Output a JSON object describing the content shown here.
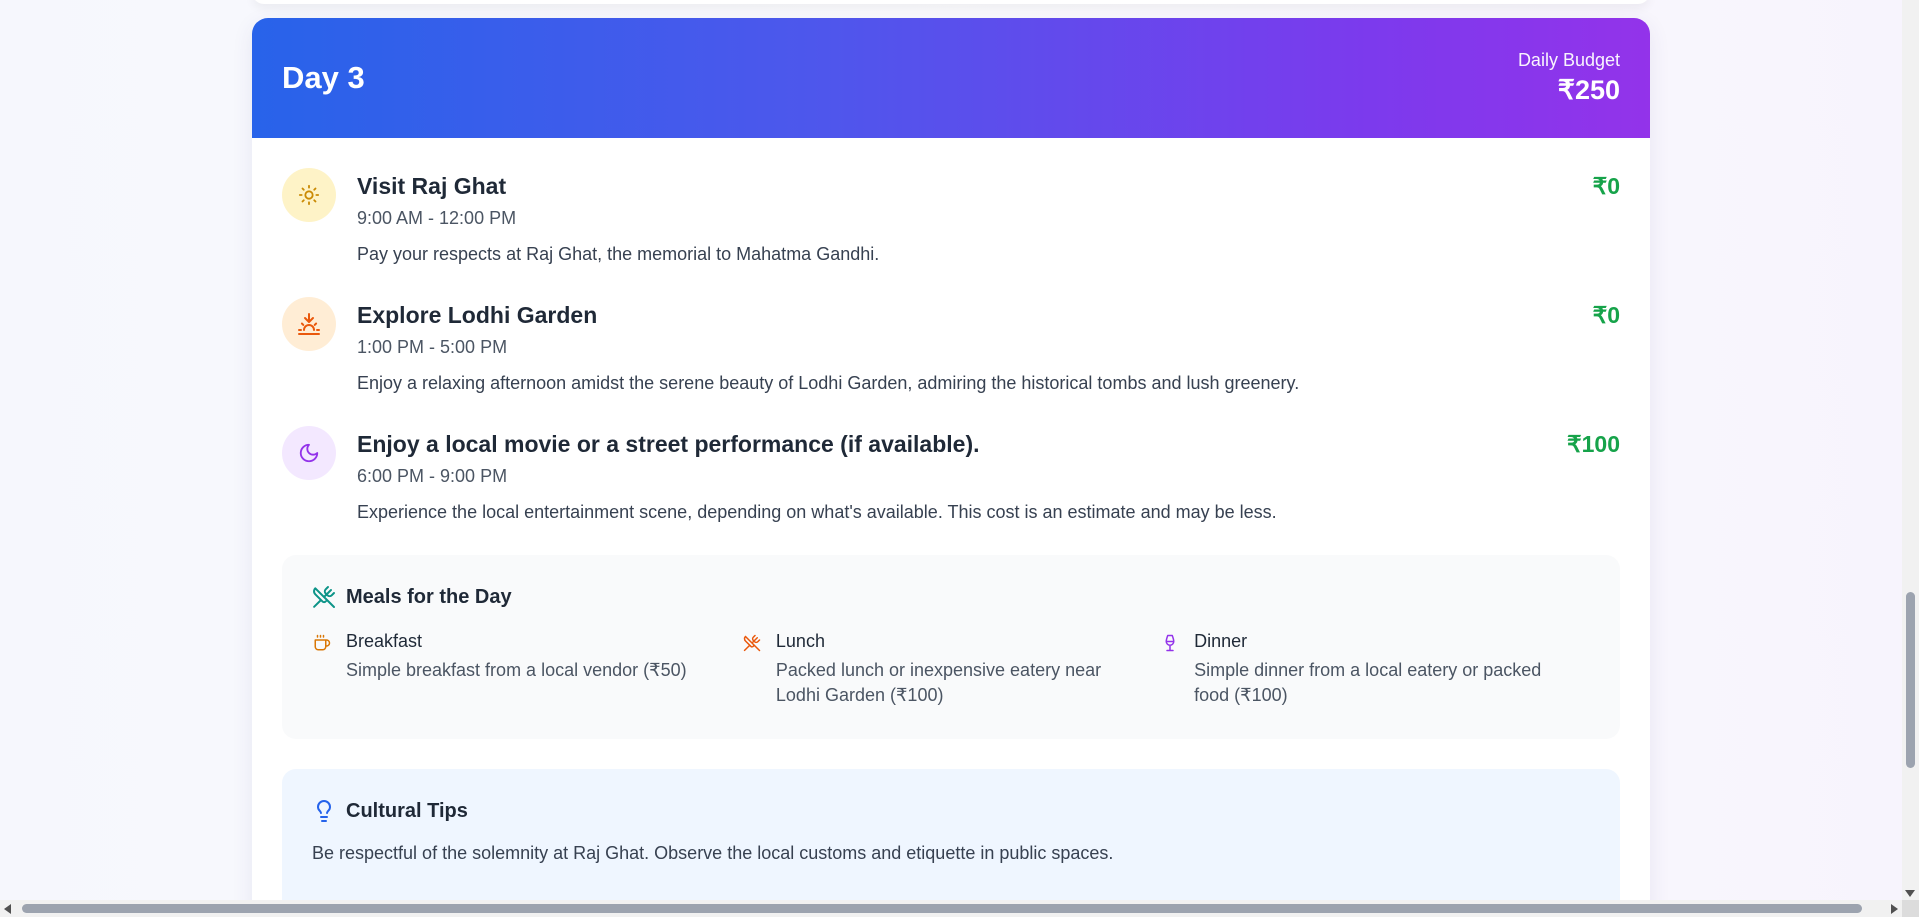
{
  "day": {
    "title": "Day 3",
    "budget_label": "Daily Budget",
    "budget_value": "₹250"
  },
  "activities": [
    {
      "icon": "sun-icon",
      "title": "Visit Raj Ghat",
      "time": "9:00 AM - 12:00 PM",
      "description": "Pay your respects at Raj Ghat, the memorial to Mahatma Gandhi.",
      "cost": "₹0"
    },
    {
      "icon": "sunset-icon",
      "title": "Explore Lodhi Garden",
      "time": "1:00 PM - 5:00 PM",
      "description": "Enjoy a relaxing afternoon amidst the serene beauty of Lodhi Garden, admiring the historical tombs and lush greenery.",
      "cost": "₹0"
    },
    {
      "icon": "moon-icon",
      "title": "Enjoy a local movie or a street performance (if available).",
      "time": "6:00 PM - 9:00 PM",
      "description": "Experience the local entertainment scene, depending on what's available. This cost is an estimate and may be less.",
      "cost": "₹100"
    }
  ],
  "meals": {
    "title": "Meals for the Day",
    "items": [
      {
        "icon": "coffee-icon",
        "name": "Breakfast",
        "description": "Simple breakfast from a local vendor (₹50)"
      },
      {
        "icon": "utensils-icon",
        "name": "Lunch",
        "description": "Packed lunch or inexpensive eatery near Lodhi Garden (₹100)"
      },
      {
        "icon": "wine-glass-icon",
        "name": "Dinner",
        "description": "Simple dinner from a local eatery or packed food (₹100)"
      }
    ]
  },
  "tips": {
    "title": "Cultural Tips",
    "text": "Be respectful of the solemnity at Raj Ghat. Observe the local customs and etiquette in public spaces."
  },
  "colors": {
    "header_start": "#2563eb",
    "header_end": "#9333ea",
    "cost": "#16a34a"
  }
}
